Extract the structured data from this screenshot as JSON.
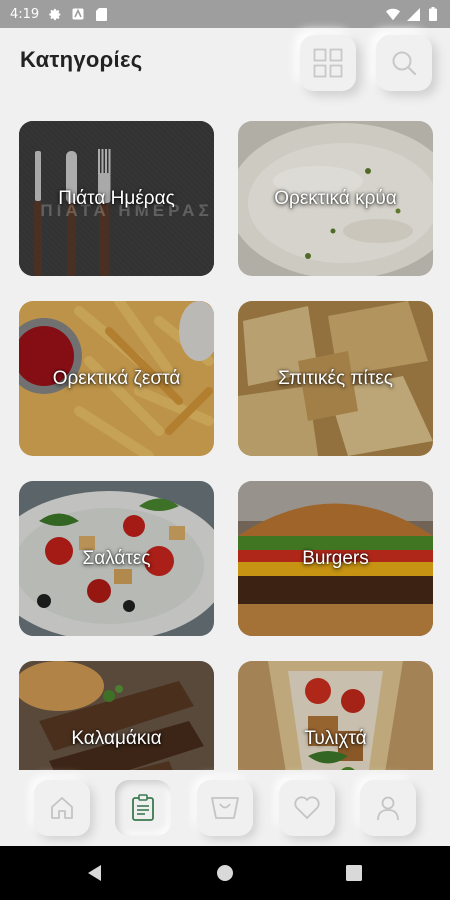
{
  "status_bar": {
    "time": "4:19",
    "icons": [
      "gear-icon",
      "app-notification-icon",
      "sd-card-icon",
      "wifi-icon",
      "signal-icon",
      "battery-icon"
    ]
  },
  "header": {
    "title": "Κατηγορίες",
    "buttons": [
      "grid-view-icon",
      "search-icon"
    ]
  },
  "categories": [
    {
      "label": "Πιάτα Ημέρας",
      "watermark": "ΠΙΑΤΑ ΗΜΕΡΑΣ"
    },
    {
      "label": "Ορεκτικά κρύα"
    },
    {
      "label": "Ορεκτικά ζεστά"
    },
    {
      "label": "Σπιτικές πίτες"
    },
    {
      "label": "Σαλάτες"
    },
    {
      "label": "Burgers"
    },
    {
      "label": "Καλαμάκια"
    },
    {
      "label": "Τυλιχτά"
    }
  ],
  "bottom_nav": {
    "items": [
      "home-icon",
      "menu-icon",
      "cart-icon",
      "favorites-icon",
      "profile-icon"
    ],
    "active": "menu-icon"
  },
  "colors": {
    "background": "#f0f0f0",
    "status_bar": "#9e9e9e",
    "active_nav_icon": "#3a7a50",
    "inactive_nav_icon": "#c4c4c4"
  }
}
